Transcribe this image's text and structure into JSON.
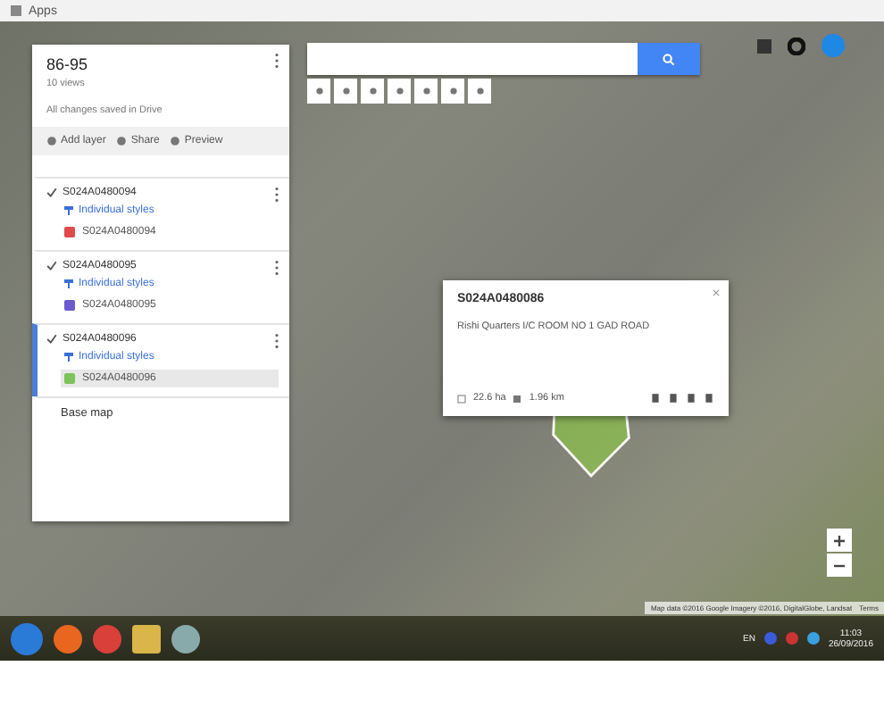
{
  "bookmarks_bar": {
    "items": [
      "Apps"
    ]
  },
  "map_panel": {
    "title": "86-95",
    "views": "10 views",
    "save_status": "All changes saved in Drive",
    "actions": [
      "Add layer",
      "Share",
      "Preview"
    ],
    "layers": [
      {
        "name": "S024A0480094",
        "checked": true,
        "style": "Individual styles",
        "feature": "S024A0480094",
        "color": "#e04a4a",
        "selected": false
      },
      {
        "name": "S024A0480095",
        "checked": true,
        "style": "Individual styles",
        "feature": "S024A0480095",
        "color": "#6a5acd",
        "selected": false
      },
      {
        "name": "S024A0480096",
        "checked": true,
        "style": "Individual styles",
        "feature": "S024A0480096",
        "color": "#7cc35a",
        "selected": true
      }
    ],
    "base_map": "Base map"
  },
  "popup": {
    "title": "S024A0480086",
    "description": "Rishi Quarters I/C ROOM NO 1 GAD ROAD",
    "area": "22.6 ha",
    "perimeter": "1.96 km"
  },
  "map_footer": {
    "attribution": "Map data ©2016 Google Imagery ©2016, DigitalGlobe, Landsat",
    "terms": "Terms"
  },
  "taskbar": {
    "language": "EN",
    "time": "11:03",
    "date": "26/09/2016"
  }
}
